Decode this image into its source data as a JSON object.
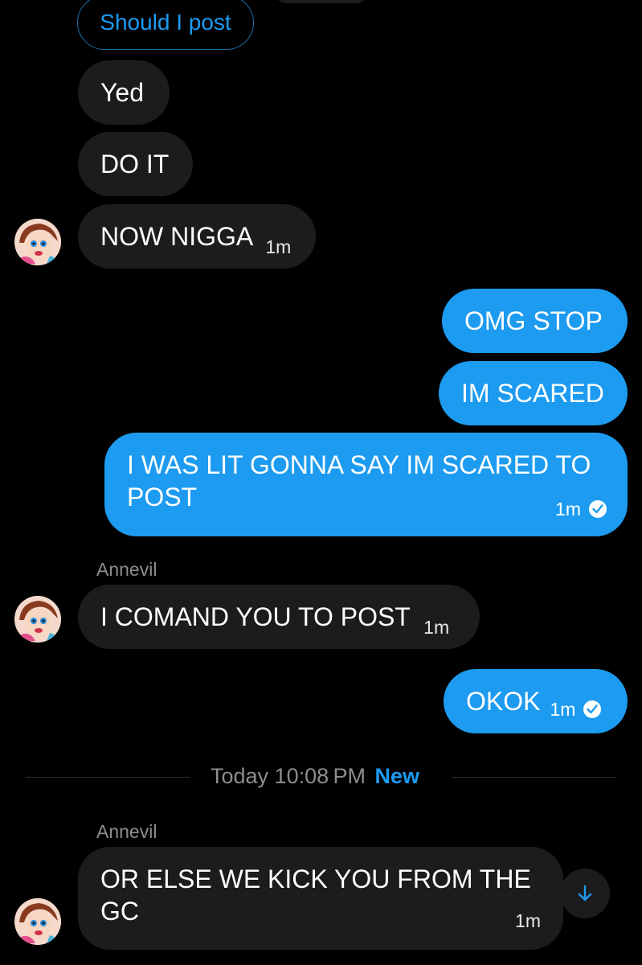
{
  "messages": {
    "m0": {
      "text": "Should I post"
    },
    "m1": {
      "text": "Yed"
    },
    "m2": {
      "text": "DO IT"
    },
    "m3": {
      "text": "NOW NIGGA",
      "time": "1m"
    },
    "m4": {
      "text": "OMG STOP"
    },
    "m5": {
      "text": "IM SCARED"
    },
    "m6": {
      "line1": "I WAS LIT GONNA SAY IM SCARED TO",
      "line2": "POST",
      "time": "1m"
    },
    "m7": {
      "sender": "Annevil",
      "text": "I COMAND YOU TO POST",
      "time": "1m"
    },
    "m8": {
      "text": "OKOK",
      "time": "1m"
    },
    "m9": {
      "sender": "Annevil",
      "line1": "OR ELSE WE KICK YOU FROM THE",
      "line2": "GC",
      "time": "1m"
    }
  },
  "divider": {
    "text": "Today 10:08 PM",
    "new_label": "New"
  },
  "colors": {
    "background": "#000000",
    "incoming_bubble": "#1c1c1e",
    "outgoing_bubble": "#1d9bf0",
    "accent": "#1d9bf0",
    "muted_text": "#8b8d91"
  },
  "icons": {
    "read_receipt": "check-circle-icon",
    "scroll_down": "arrow-down-icon",
    "avatar": "user-avatar"
  }
}
